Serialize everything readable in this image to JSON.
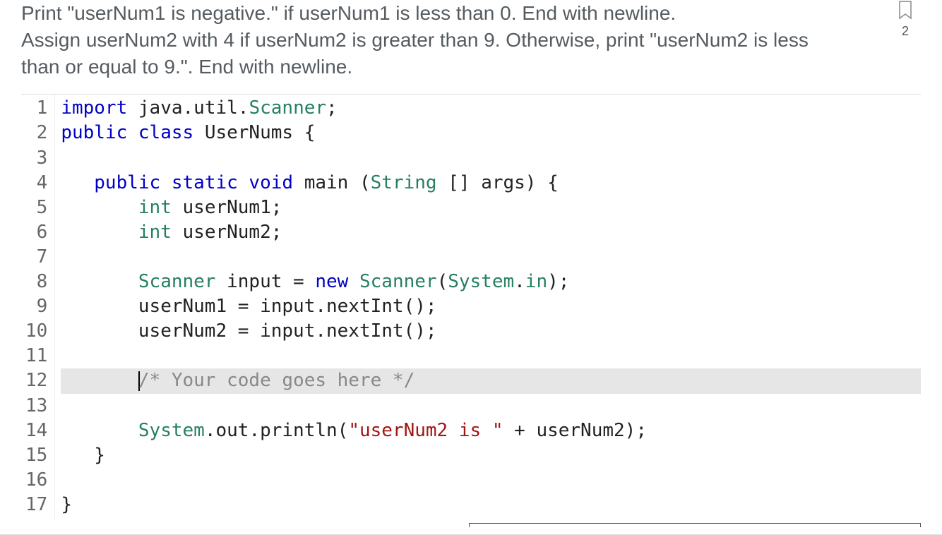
{
  "instructions": {
    "line1": "Print \"userNum1 is negative.\" if userNum1 is less than 0. End with newline.",
    "line2": "Assign userNum2 with 4 if userNum2 is greater than 9. Otherwise, print \"userNum2 is less than or equal to 9.\". End with newline."
  },
  "badge": {
    "count": "2"
  },
  "editor": {
    "active_line_index": 11,
    "lines": [
      {
        "n": "1",
        "tokens": [
          {
            "t": "import ",
            "c": "kw"
          },
          {
            "t": "java",
            "c": "id"
          },
          {
            "t": ".",
            "c": "id"
          },
          {
            "t": "util",
            "c": "id"
          },
          {
            "t": ".",
            "c": "id"
          },
          {
            "t": "Scanner",
            "c": "cls"
          },
          {
            "t": ";",
            "c": "id"
          }
        ]
      },
      {
        "n": "2",
        "tokens": [
          {
            "t": "public class ",
            "c": "kw"
          },
          {
            "t": "UserNums",
            "c": "id"
          },
          {
            "t": " {",
            "c": "id"
          }
        ]
      },
      {
        "n": "3",
        "tokens": []
      },
      {
        "n": "4",
        "tokens": [
          {
            "t": "   ",
            "c": "id"
          },
          {
            "t": "public static void ",
            "c": "kw"
          },
          {
            "t": "main ",
            "c": "id"
          },
          {
            "t": "(",
            "c": "id"
          },
          {
            "t": "String ",
            "c": "cls"
          },
          {
            "t": "[] ",
            "c": "id"
          },
          {
            "t": "args) {",
            "c": "id"
          }
        ]
      },
      {
        "n": "5",
        "tokens": [
          {
            "t": "       ",
            "c": "id"
          },
          {
            "t": "int ",
            "c": "type"
          },
          {
            "t": "userNum1;",
            "c": "id"
          }
        ]
      },
      {
        "n": "6",
        "tokens": [
          {
            "t": "       ",
            "c": "id"
          },
          {
            "t": "int ",
            "c": "type"
          },
          {
            "t": "userNum2;",
            "c": "id"
          }
        ]
      },
      {
        "n": "7",
        "tokens": []
      },
      {
        "n": "8",
        "tokens": [
          {
            "t": "       ",
            "c": "id"
          },
          {
            "t": "Scanner ",
            "c": "cls"
          },
          {
            "t": "input = ",
            "c": "id"
          },
          {
            "t": "new ",
            "c": "kw"
          },
          {
            "t": "Scanner",
            "c": "cls"
          },
          {
            "t": "(",
            "c": "id"
          },
          {
            "t": "System",
            "c": "cls"
          },
          {
            "t": ".",
            "c": "id"
          },
          {
            "t": "in",
            "c": "type"
          },
          {
            "t": ");",
            "c": "id"
          }
        ]
      },
      {
        "n": "9",
        "tokens": [
          {
            "t": "       ",
            "c": "id"
          },
          {
            "t": "userNum1 = input.nextInt();",
            "c": "id"
          }
        ]
      },
      {
        "n": "10",
        "tokens": [
          {
            "t": "       ",
            "c": "id"
          },
          {
            "t": "userNum2 = input.nextInt();",
            "c": "id"
          }
        ]
      },
      {
        "n": "11",
        "tokens": []
      },
      {
        "n": "12",
        "tokens": [
          {
            "t": "       ",
            "c": "id"
          },
          {
            "t": "/* Your code goes here */",
            "c": "cmt"
          }
        ],
        "cursor_before_index": 1
      },
      {
        "n": "13",
        "tokens": []
      },
      {
        "n": "14",
        "tokens": [
          {
            "t": "       ",
            "c": "id"
          },
          {
            "t": "System",
            "c": "cls"
          },
          {
            "t": ".",
            "c": "id"
          },
          {
            "t": "out",
            "c": "id"
          },
          {
            "t": ".",
            "c": "id"
          },
          {
            "t": "println(",
            "c": "id"
          },
          {
            "t": "\"userNum2 is \"",
            "c": "str"
          },
          {
            "t": " + userNum2);",
            "c": "id"
          }
        ]
      },
      {
        "n": "15",
        "tokens": [
          {
            "t": "   }",
            "c": "id"
          }
        ]
      },
      {
        "n": "16",
        "tokens": []
      },
      {
        "n": "17",
        "tokens": [
          {
            "t": "}",
            "c": "id"
          }
        ]
      }
    ]
  }
}
